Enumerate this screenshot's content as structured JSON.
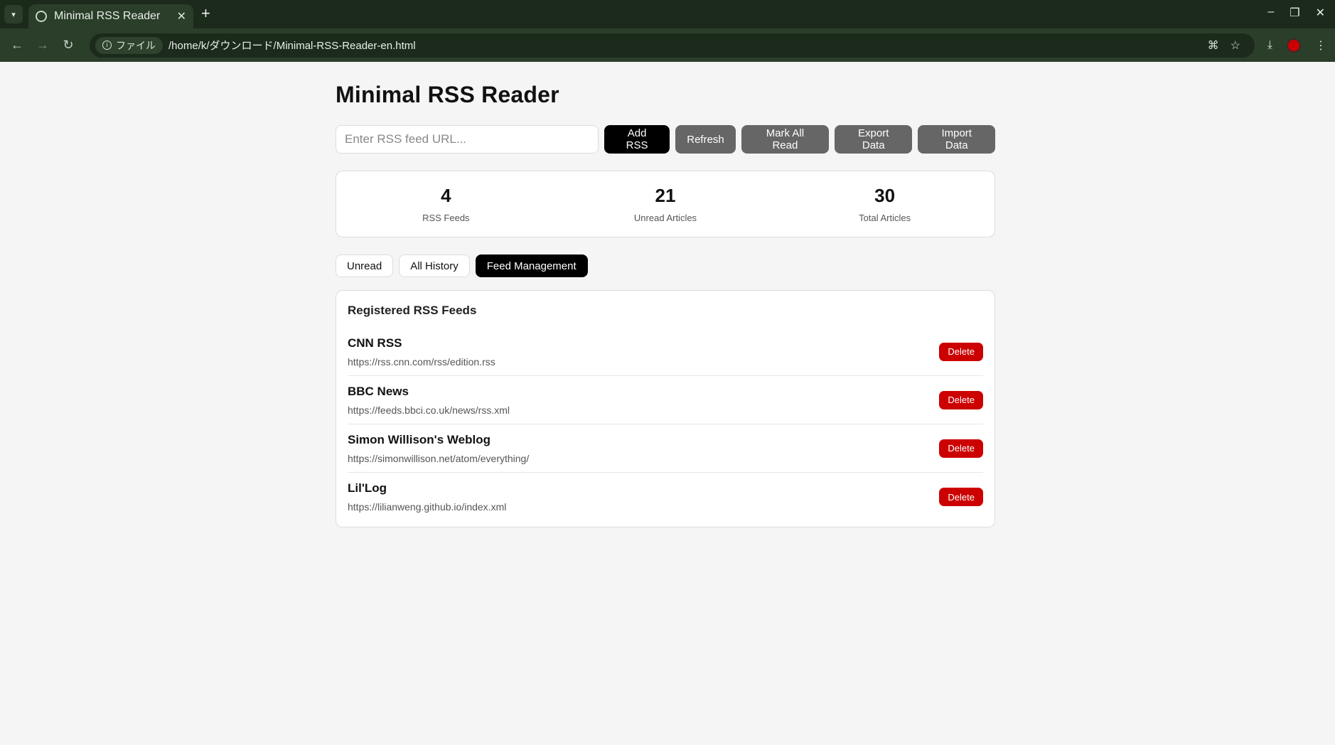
{
  "browser": {
    "tab_title": "Minimal RSS Reader",
    "scheme_label": "ファイル",
    "url": "/home/k/ダウンロード/Minimal-RSS-Reader-en.html"
  },
  "app": {
    "title": "Minimal RSS Reader",
    "input_placeholder": "Enter RSS feed URL...",
    "buttons": {
      "add": "Add RSS",
      "refresh": "Refresh",
      "mark_all": "Mark All Read",
      "export": "Export Data",
      "import": "Import Data"
    },
    "stats": [
      {
        "value": "4",
        "label": "RSS Feeds"
      },
      {
        "value": "21",
        "label": "Unread Articles"
      },
      {
        "value": "30",
        "label": "Total Articles"
      }
    ],
    "tabs": [
      {
        "label": "Unread",
        "active": false
      },
      {
        "label": "All History",
        "active": false
      },
      {
        "label": "Feed Management",
        "active": true
      }
    ],
    "panel_title": "Registered RSS Feeds",
    "delete_label": "Delete",
    "feeds": [
      {
        "name": "CNN RSS",
        "url": "https://rss.cnn.com/rss/edition.rss"
      },
      {
        "name": "BBC News",
        "url": "https://feeds.bbci.co.uk/news/rss.xml"
      },
      {
        "name": "Simon Willison's Weblog",
        "url": "https://simonwillison.net/atom/everything/"
      },
      {
        "name": "Lil'Log",
        "url": "https://lilianweng.github.io/index.xml"
      }
    ]
  },
  "colors": {
    "primary_button": "#000000",
    "secondary_button": "#666666",
    "delete_button": "#cc0000",
    "browser_frame": "#1b2a1b"
  }
}
